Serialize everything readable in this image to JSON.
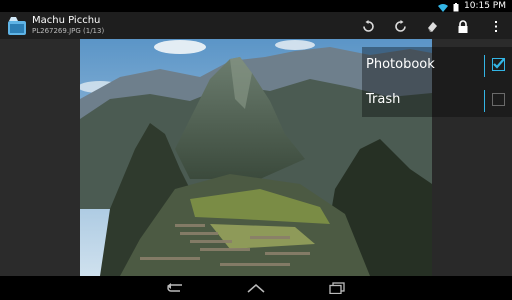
{
  "status": {
    "time": "10:15 PM"
  },
  "actionbar": {
    "title": "Machu Picchu",
    "subtitle": "PL267269.JPG (1/13)",
    "buttons": [
      "rotate-left-icon",
      "rotate-right-icon",
      "eraser-icon",
      "lock-icon",
      "overflow-menu-icon"
    ]
  },
  "albums": [
    {
      "label": "Photobook",
      "checked": true
    },
    {
      "label": "Trash",
      "checked": false
    }
  ],
  "nav": [
    "back-icon",
    "home-icon",
    "recent-apps-icon"
  ],
  "colors": {
    "accent": "#33b5e5",
    "actionbar": "#1e1e1e"
  }
}
